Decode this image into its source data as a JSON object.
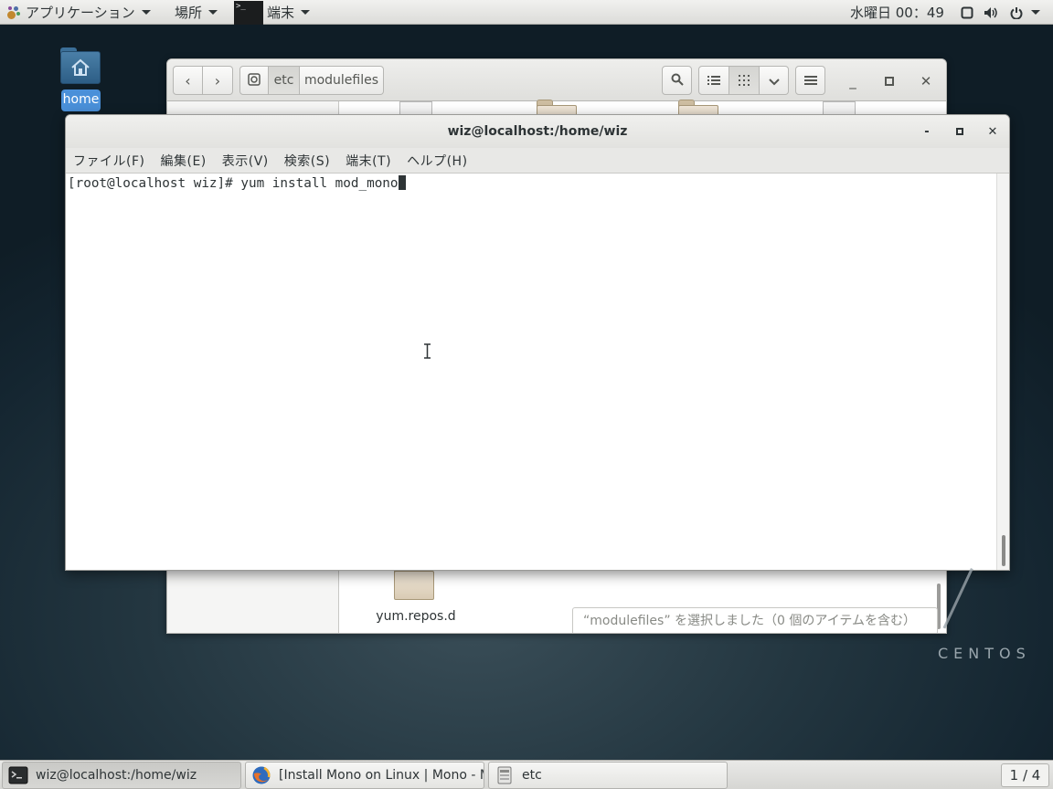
{
  "top_panel": {
    "applications_label": "アプリケーション",
    "places_label": "場所",
    "active_app_label": "端末",
    "clock": "水曜日 00：49"
  },
  "desktop": {
    "home_label": "home"
  },
  "files_window": {
    "path": [
      "etc",
      "modulefiles"
    ],
    "visible_folder_label": "yum.repos.d",
    "status_text": "“modulefiles” を選択しました（0 個のアイテムを含む）"
  },
  "terminal": {
    "title": "wiz@localhost:/home/wiz",
    "menus": [
      "ファイル(F)",
      "編集(E)",
      "表示(V)",
      "検索(S)",
      "端末(T)",
      "ヘルプ(H)"
    ],
    "prompt": "[root@localhost wiz]# ",
    "command": "yum install mod_mono"
  },
  "watermark": "CENTOS",
  "taskbar": {
    "tasks": [
      {
        "label": "wiz@localhost:/home/wiz",
        "icon": "terminal-icon",
        "active": true
      },
      {
        "label": "[Install Mono on Linux | Mono - M…",
        "icon": "firefox-icon",
        "active": false
      },
      {
        "label": "etc",
        "icon": "file-manager-icon",
        "active": false
      }
    ],
    "workspace": "1 / 4"
  },
  "colors": {
    "selection_blue": "#4a90d9",
    "panel_bg": "#e6e6e4",
    "desktop_bg": "#1a2b35"
  }
}
